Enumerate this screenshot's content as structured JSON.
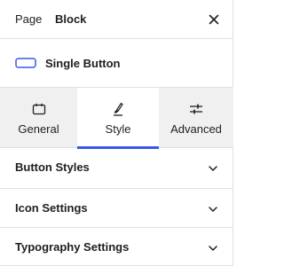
{
  "header": {
    "tabs": [
      {
        "label": "Page"
      },
      {
        "label": "Block"
      }
    ],
    "close_icon": "close-icon"
  },
  "block_card": {
    "icon": "button-icon",
    "title": "Single Button"
  },
  "style_tabs": [
    {
      "label": "General",
      "icon": "calendar-icon"
    },
    {
      "label": "Style",
      "icon": "brush-icon",
      "active": true
    },
    {
      "label": "Advanced",
      "icon": "sliders-icon"
    }
  ],
  "sections": [
    {
      "label": "Button Styles",
      "icon": "chevron-down-icon"
    },
    {
      "label": "Icon Settings",
      "icon": "chevron-down-icon"
    },
    {
      "label": "Typography Settings",
      "icon": "chevron-down-icon"
    }
  ],
  "colors": {
    "accent": "#3858e9",
    "tab_bg": "#f0f0f0",
    "border": "#e0e0e0",
    "text": "#1e1e1e"
  }
}
